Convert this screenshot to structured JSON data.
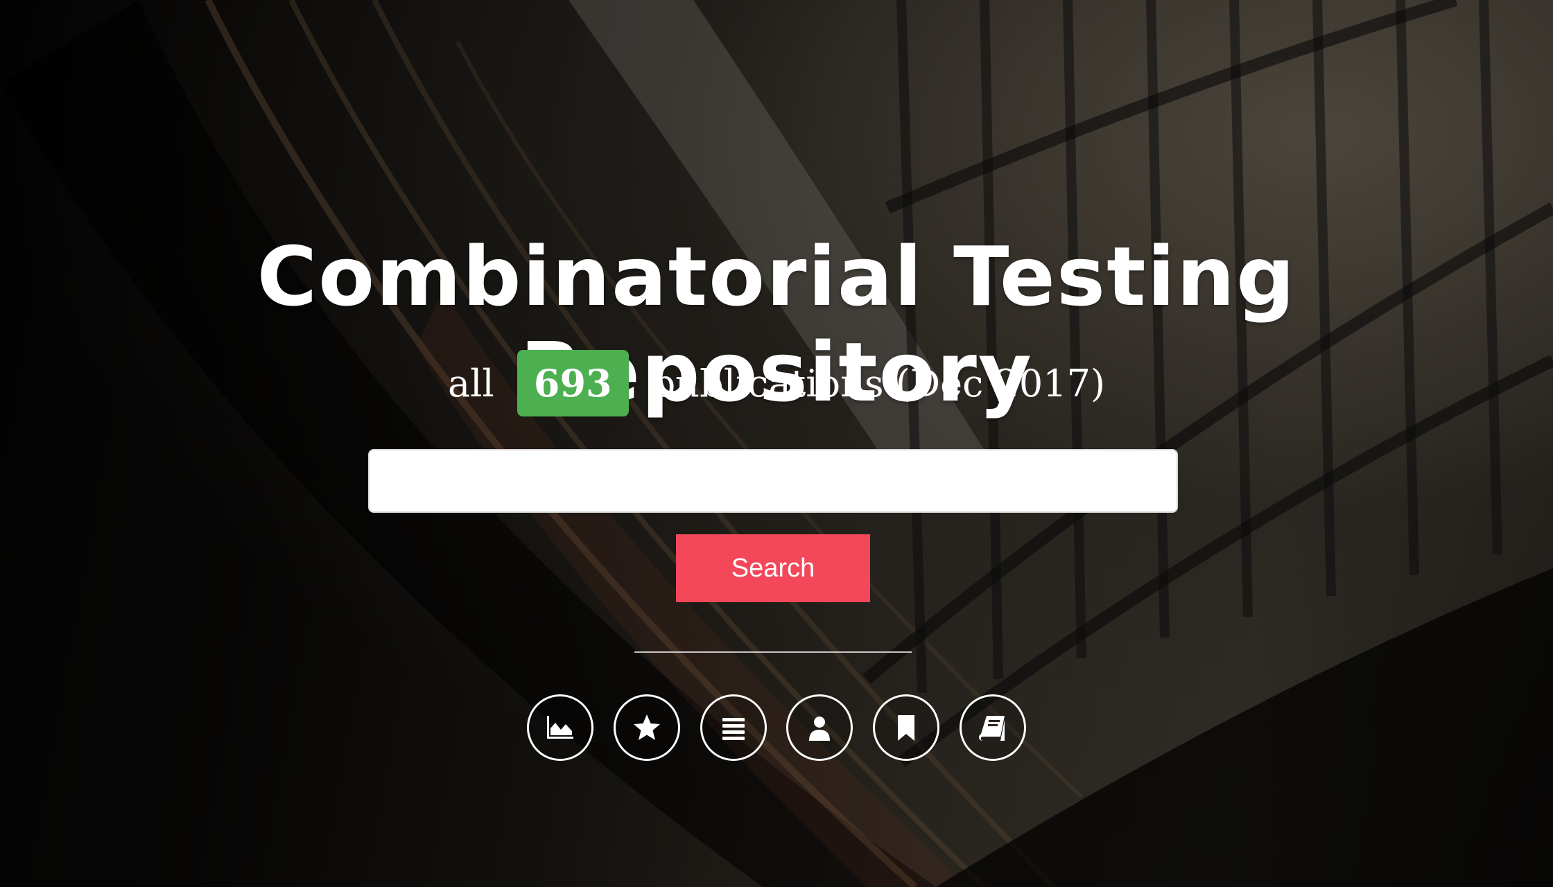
{
  "hero": {
    "title": "Combinatorial Testing Repository",
    "subtitle_prefix": "all",
    "count": "693",
    "subtitle_suffix": "publications (Dec 2017)"
  },
  "search": {
    "input_value": "",
    "placeholder": "",
    "button_label": "Search"
  },
  "nav_icons": [
    {
      "name": "area-chart-icon"
    },
    {
      "name": "star-icon"
    },
    {
      "name": "list-icon"
    },
    {
      "name": "user-icon"
    },
    {
      "name": "bookmark-icon"
    },
    {
      "name": "book-icon"
    }
  ],
  "colors": {
    "badge": "#4caf50",
    "search_button": "#f4475a",
    "text": "#ffffff"
  }
}
